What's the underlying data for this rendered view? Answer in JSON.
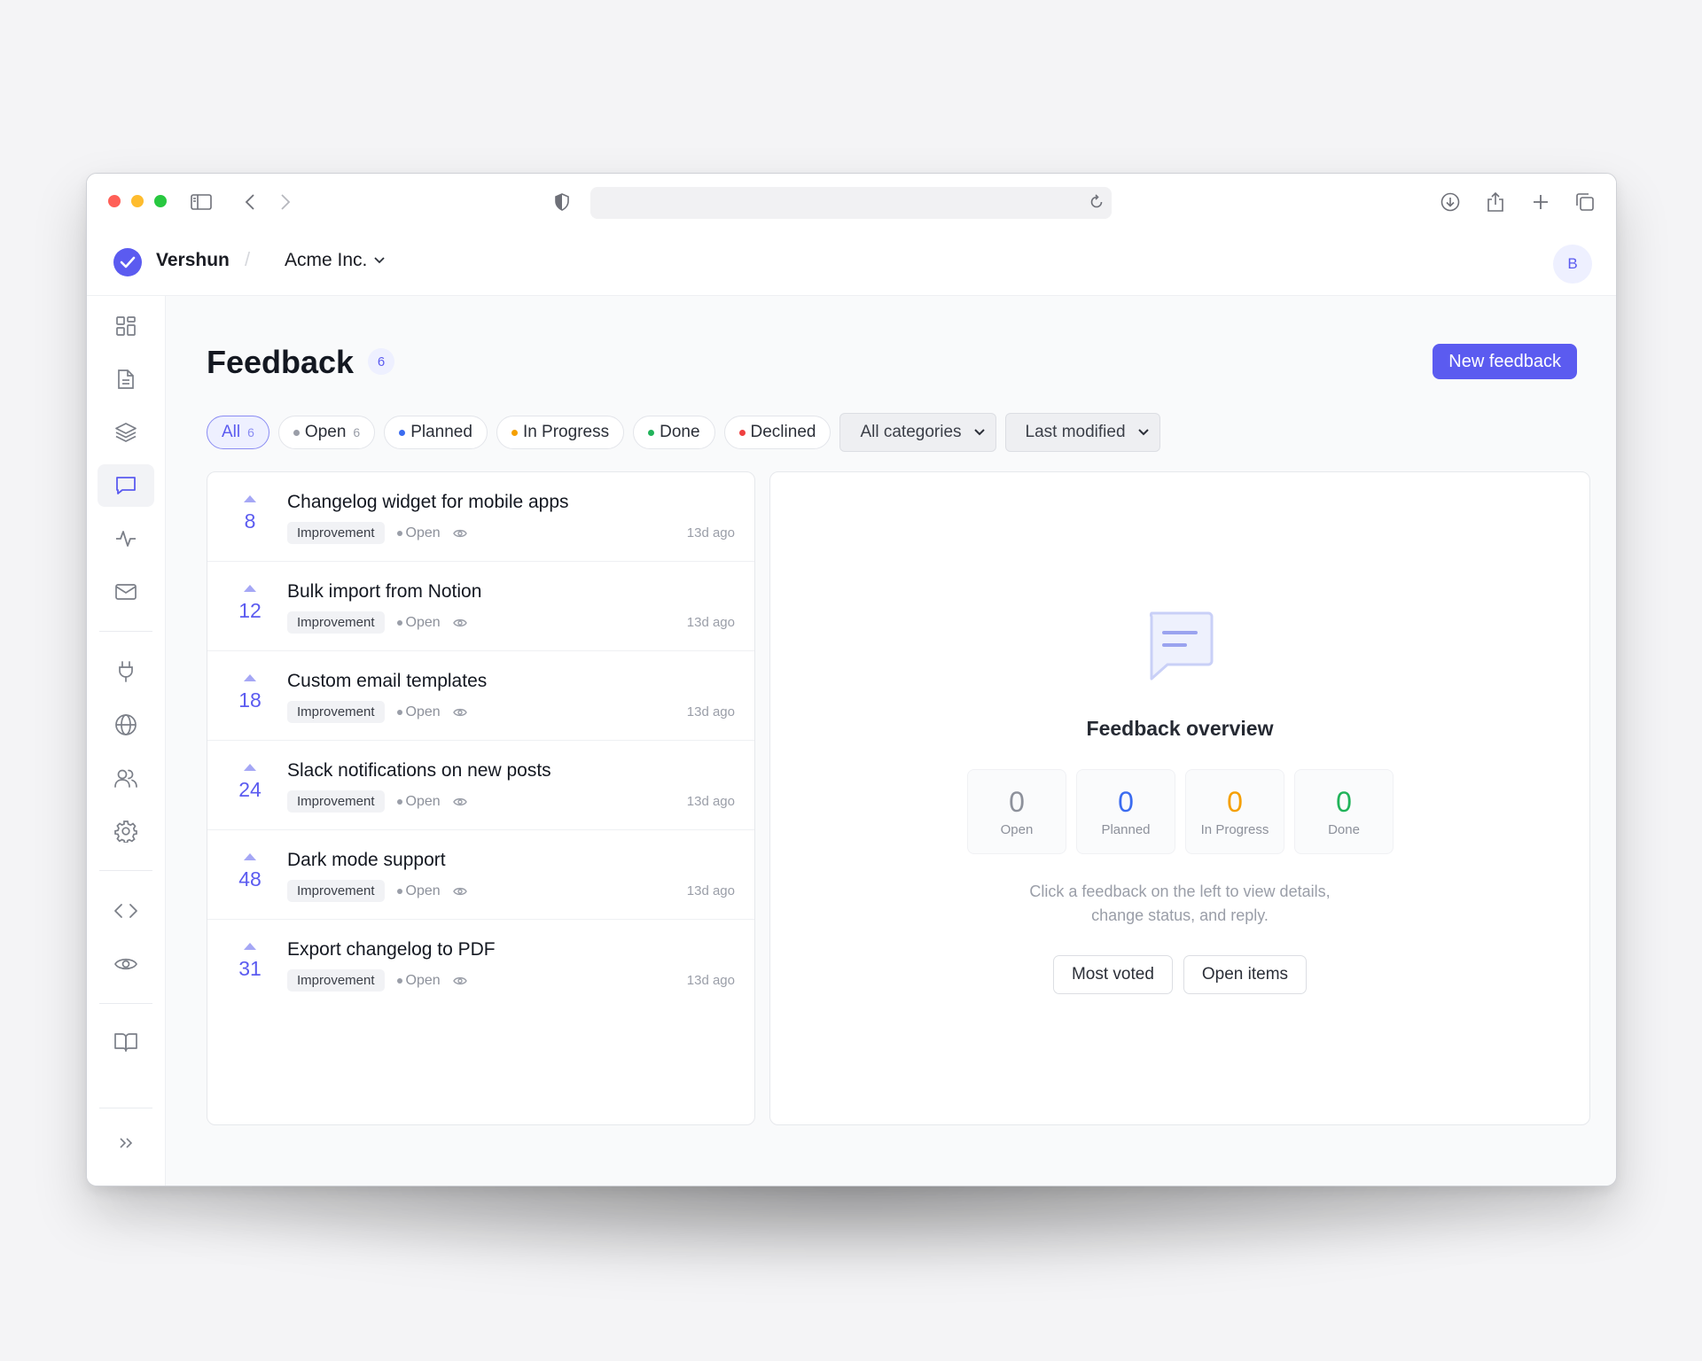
{
  "app": {
    "brand": "Vershun",
    "org": "Acme Inc.",
    "avatar_initial": "B"
  },
  "page": {
    "title": "Feedback",
    "count": "6",
    "new_button": "New feedback"
  },
  "filters": {
    "chips": [
      {
        "label": "All",
        "count": "6",
        "active": true
      },
      {
        "label": "Open",
        "count": "6",
        "dot": "#9a9ea8"
      },
      {
        "label": "Planned",
        "dot": "#3b6cf0"
      },
      {
        "label": "In Progress",
        "dot": "#f5a000"
      },
      {
        "label": "Done",
        "dot": "#21b35a"
      },
      {
        "label": "Declined",
        "dot": "#ef4040"
      }
    ],
    "category_select": "All categories",
    "sort_select": "Last modified"
  },
  "feedback": [
    {
      "votes": "8",
      "title": "Changelog widget for mobile apps",
      "tag": "Improvement",
      "status": "Open",
      "time": "13d ago"
    },
    {
      "votes": "12",
      "title": "Bulk import from Notion",
      "tag": "Improvement",
      "status": "Open",
      "time": "13d ago"
    },
    {
      "votes": "18",
      "title": "Custom email templates",
      "tag": "Improvement",
      "status": "Open",
      "time": "13d ago"
    },
    {
      "votes": "24",
      "title": "Slack notifications on new posts",
      "tag": "Improvement",
      "status": "Open",
      "time": "13d ago"
    },
    {
      "votes": "48",
      "title": "Dark mode support",
      "tag": "Improvement",
      "status": "Open",
      "time": "13d ago"
    },
    {
      "votes": "31",
      "title": "Export changelog to PDF",
      "tag": "Improvement",
      "status": "Open",
      "time": "13d ago"
    }
  ],
  "overview": {
    "title": "Feedback overview",
    "stats": [
      {
        "value": "0",
        "label": "Open",
        "color": "#8d919b"
      },
      {
        "value": "0",
        "label": "Planned",
        "color": "#3b6cf0"
      },
      {
        "value": "0",
        "label": "In Progress",
        "color": "#f5a000"
      },
      {
        "value": "0",
        "label": "Done",
        "color": "#21b35a"
      }
    ],
    "help_line1": "Click a feedback on the left to view details,",
    "help_line2": "change status, and reply.",
    "btn_most_voted": "Most voted",
    "btn_open_items": "Open items"
  },
  "colors": {
    "accent": "#5b5bf0"
  }
}
